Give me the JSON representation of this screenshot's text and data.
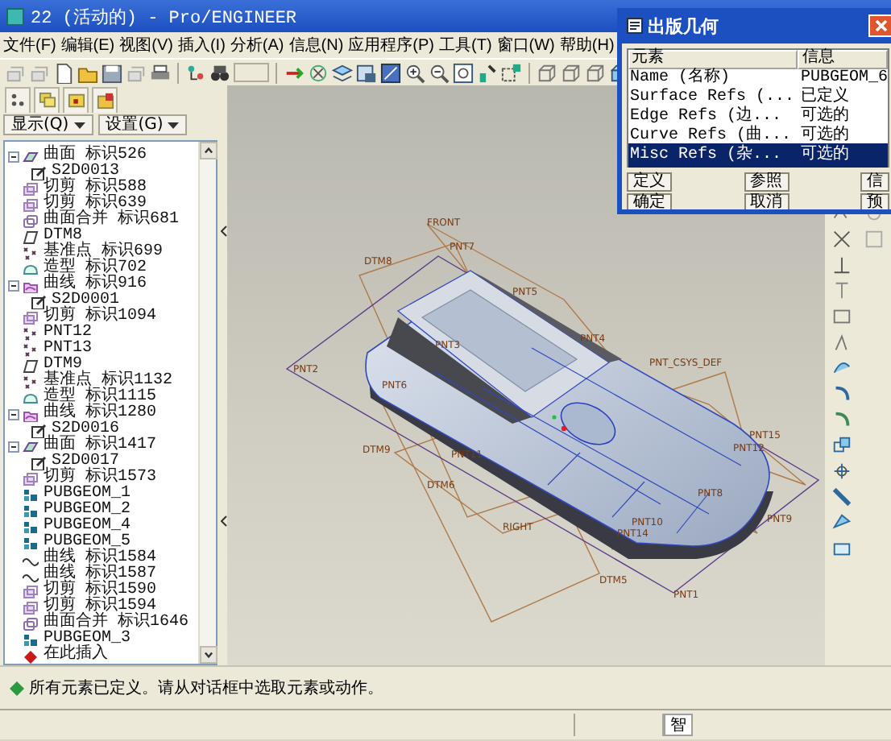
{
  "window": {
    "title": "22 (活动的) - Pro/ENGINEER"
  },
  "menu": [
    "文件(F)",
    "编辑(E)",
    "视图(V)",
    "插入(I)",
    "分析(A)",
    "信息(N)",
    "应用程序(P)",
    "工具(T)",
    "窗口(W)",
    "帮助(H)"
  ],
  "model_tree": {
    "buttons": [
      "显示(Q)",
      "设置(G)"
    ],
    "items": [
      {
        "label": "曲面 标识526",
        "kind": "surface",
        "expanded": true,
        "children": [
          {
            "label": "S2D0013",
            "kind": "sketch"
          }
        ]
      },
      {
        "label": "切剪 标识588",
        "kind": "cut"
      },
      {
        "label": "切剪 标识639",
        "kind": "cut"
      },
      {
        "label": "曲面合并 标识681",
        "kind": "merge"
      },
      {
        "label": "DTM8",
        "kind": "datum_plane"
      },
      {
        "label": "基准点 标识699",
        "kind": "datum_point"
      },
      {
        "label": "造型 标识702",
        "kind": "style"
      },
      {
        "label": "曲线 标识916",
        "kind": "curve_feature",
        "expanded": true,
        "children": [
          {
            "label": "S2D0001",
            "kind": "sketch"
          }
        ]
      },
      {
        "label": "切剪 标识1094",
        "kind": "cut"
      },
      {
        "label": "PNT12",
        "kind": "datum_point"
      },
      {
        "label": "PNT13",
        "kind": "datum_point"
      },
      {
        "label": "DTM9",
        "kind": "datum_plane"
      },
      {
        "label": "基准点 标识1132",
        "kind": "datum_point"
      },
      {
        "label": "造型 标识1115",
        "kind": "style"
      },
      {
        "label": "曲线 标识1280",
        "kind": "curve_feature",
        "expanded": true,
        "children": [
          {
            "label": "S2D0016",
            "kind": "sketch"
          }
        ]
      },
      {
        "label": "曲面 标识1417",
        "kind": "surface",
        "expanded": true,
        "children": [
          {
            "label": "S2D0017",
            "kind": "sketch"
          }
        ]
      },
      {
        "label": "切剪 标识1573",
        "kind": "cut"
      },
      {
        "label": "PUBGEOM_1",
        "kind": "pubgeom"
      },
      {
        "label": "PUBGEOM_2",
        "kind": "pubgeom"
      },
      {
        "label": "PUBGEOM_4",
        "kind": "pubgeom"
      },
      {
        "label": "PUBGEOM_5",
        "kind": "pubgeom"
      },
      {
        "label": "曲线 标识1584",
        "kind": "curve"
      },
      {
        "label": "曲线 标识1587",
        "kind": "curve"
      },
      {
        "label": "切剪 标识1590",
        "kind": "cut"
      },
      {
        "label": "切剪 标识1594",
        "kind": "cut"
      },
      {
        "label": "曲面合并 标识1646",
        "kind": "merge"
      },
      {
        "label": "PUBGEOM_3",
        "kind": "pubgeom"
      },
      {
        "label": "在此插入",
        "kind": "insert"
      }
    ]
  },
  "viewport": {
    "labels": [
      "FRONT",
      "PNT7",
      "DTM8",
      "PNT5",
      "PNT2",
      "PNT6",
      "PNT4",
      "PNT_CSYS_DEF",
      "PNT15",
      "PNT12",
      "DTM9",
      "PNT11",
      "DTM6",
      "RIGHT",
      "PNT8",
      "PNT10",
      "PNT14",
      "PNT9",
      "PNT3",
      "DTM5",
      "PNT1"
    ]
  },
  "dialog": {
    "title": "出版几何",
    "columns": [
      "元素",
      "信息"
    ],
    "rows": [
      {
        "element": "Name (名称)",
        "info": "PUBGEOM_6",
        "selected": false
      },
      {
        "element": "Surface Refs (...",
        "info": "已定义",
        "selected": false
      },
      {
        "element": "Edge Refs (边...",
        "info": "可选的",
        "selected": false
      },
      {
        "element": "Curve Refs (曲...",
        "info": "可选的",
        "selected": false
      },
      {
        "element": "Misc Refs (杂...",
        "info": "可选的",
        "selected": true
      }
    ],
    "buttons": [
      [
        "定义",
        "参照",
        "信"
      ],
      [
        "确定",
        "取消",
        "预"
      ]
    ]
  },
  "message": "所有元素已定义。请从对话框中选取元素或动作。",
  "status_bar": {
    "fields": [
      "智"
    ]
  }
}
